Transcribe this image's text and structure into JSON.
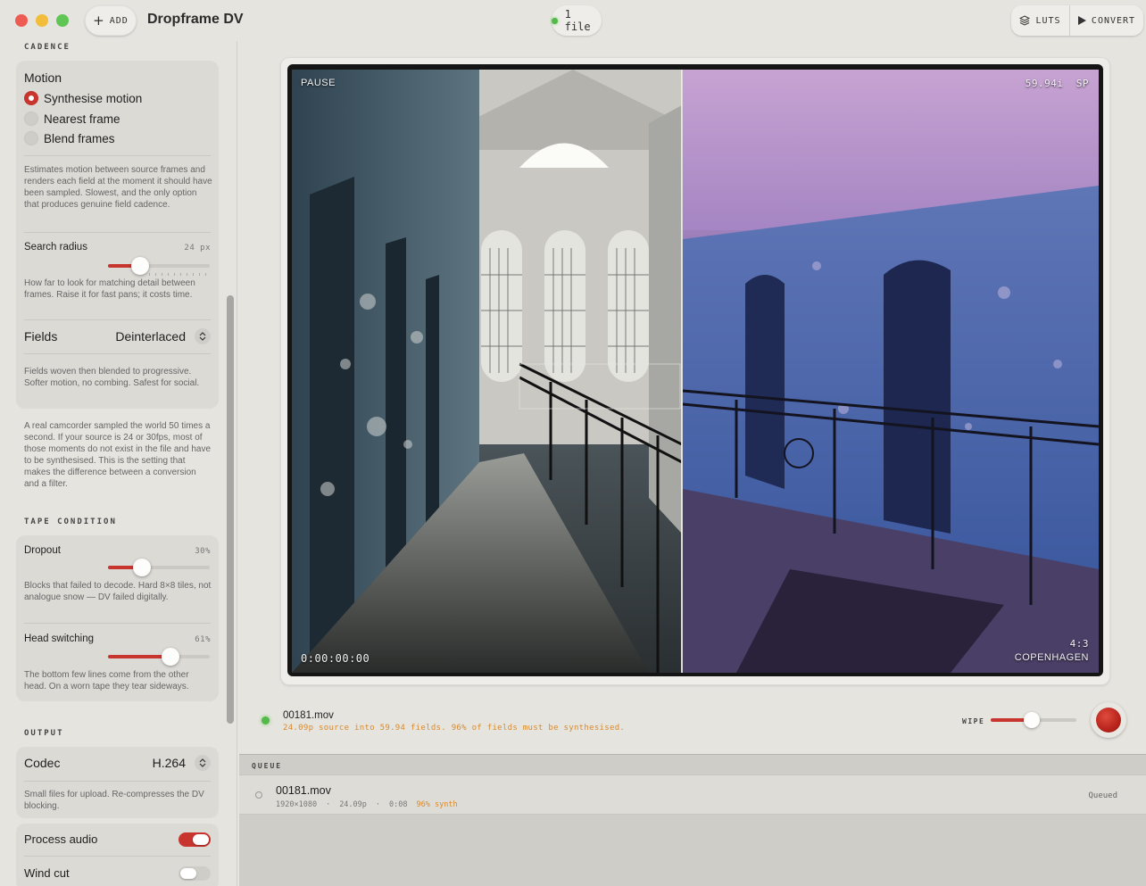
{
  "window": {
    "title": "Dropframe DV",
    "add_label": "ADD",
    "file_count": "1 file",
    "luts_label": "LUTS",
    "convert_label": "CONVERT"
  },
  "sidebar": {
    "cadence": {
      "section_label": "CADENCE",
      "motion_title": "Motion",
      "options": [
        {
          "label": "Synthesise motion",
          "selected": true
        },
        {
          "label": "Nearest frame",
          "selected": false
        },
        {
          "label": "Blend frames",
          "selected": false
        }
      ],
      "motion_desc": "Estimates motion between source frames and renders each field at the moment it should have been sampled. Slowest, and the only option that produces genuine field cadence.",
      "search_radius": {
        "label": "Search radius",
        "value_text": "24 px",
        "fraction": 0.32
      },
      "search_radius_desc": "How far to look for matching detail between frames. Raise it for fast pans; it costs time.",
      "fields": {
        "label": "Fields",
        "value": "Deinterlaced"
      },
      "fields_desc": "Fields woven then blended to progressive. Softer motion, no combing. Safest for social.",
      "note": "A real camcorder sampled the world 50 times a second. If your source is 24 or 30fps, most of those moments do not exist in the file and have to be synthesised. This is the setting that makes the difference between a conversion and a filter."
    },
    "tape": {
      "section_label": "TAPE CONDITION",
      "dropout": {
        "label": "Dropout",
        "value_text": "30%",
        "fraction": 0.33
      },
      "dropout_desc": "Blocks that failed to decode. Hard 8×8 tiles, not analogue snow — DV failed digitally.",
      "head_switching": {
        "label": "Head switching",
        "value_text": "61%",
        "fraction": 0.61
      },
      "head_switching_desc": "The bottom few lines come from the other head. On a worn tape they tear sideways."
    },
    "output": {
      "section_label": "OUTPUT",
      "codec": {
        "label": "Codec",
        "value": "H.264"
      },
      "codec_desc": "Small files for upload. Re-compresses the DV blocking.",
      "process_audio": {
        "label": "Process audio",
        "on": true
      },
      "wind_cut": {
        "label": "Wind cut",
        "on": false
      }
    }
  },
  "viewer": {
    "state": "PAUSE",
    "format": "59.94i",
    "tape_speed": "SP",
    "timecode": "0:00:00:00",
    "aspect": "4:3",
    "look": "COPENHAGEN",
    "wipe_position": 0.48
  },
  "transport": {
    "file_name": "00181.mov",
    "file_info": "24.09p source into 59.94 fields. 96% of fields must be synthesised.",
    "wipe_label": "WIPE",
    "wipe_fraction": 0.48
  },
  "queue": {
    "header": "QUEUE",
    "items": [
      {
        "name": "00181.mov",
        "resolution": "1920×1080",
        "fps": "24.09p",
        "duration": "0:08",
        "synth": "96% synth",
        "status": "Queued"
      }
    ]
  },
  "colors": {
    "accent": "#c8352e",
    "status_green": "#55b84a",
    "info_orange": "#d88a2c"
  }
}
